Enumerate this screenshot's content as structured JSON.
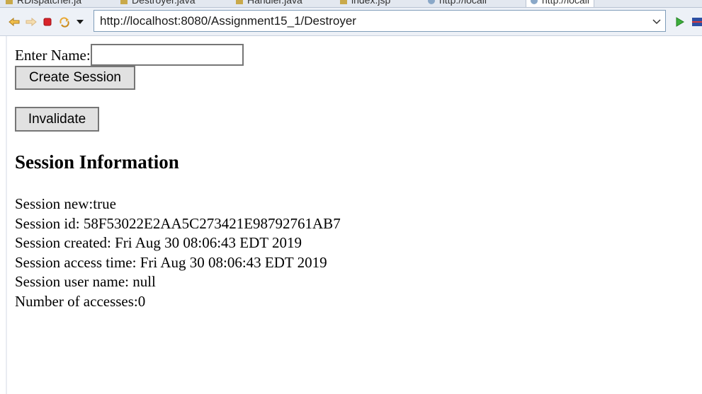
{
  "browser": {
    "tabs": [
      {
        "label": "RDispatcher.ja"
      },
      {
        "label": "Destroyer.java"
      },
      {
        "label": "Handler.java"
      },
      {
        "label": "index.jsp"
      },
      {
        "label": "http://locali"
      },
      {
        "label": "http://locali"
      }
    ],
    "address": "http://localhost:8080/Assignment15_1/Destroyer",
    "icons": {
      "back": "back-arrow-icon",
      "forward": "forward-arrow-icon",
      "stop": "stop-icon",
      "refresh": "refresh-icon",
      "menu": "dropdown-triangle-icon",
      "go": "go-play-icon",
      "extra": "toolbar-extra-icon"
    },
    "colors": {
      "stop": "#d9242b",
      "go": "#3cae3c",
      "nav_arrow": "#e8a834"
    }
  },
  "form": {
    "name_label": "Enter Name:",
    "name_value": "",
    "create_button": "Create Session",
    "invalidate_button": "Invalidate"
  },
  "session": {
    "heading": "Session Information",
    "lines": [
      "Session new:true",
      "Session id: 58F53022E2AA5C273421E98792761AB7",
      "Session created: Fri Aug 30 08:06:43 EDT 2019",
      "Session access time: Fri Aug 30 08:06:43 EDT 2019",
      "Session user name: null",
      "Number of accesses:0"
    ]
  }
}
